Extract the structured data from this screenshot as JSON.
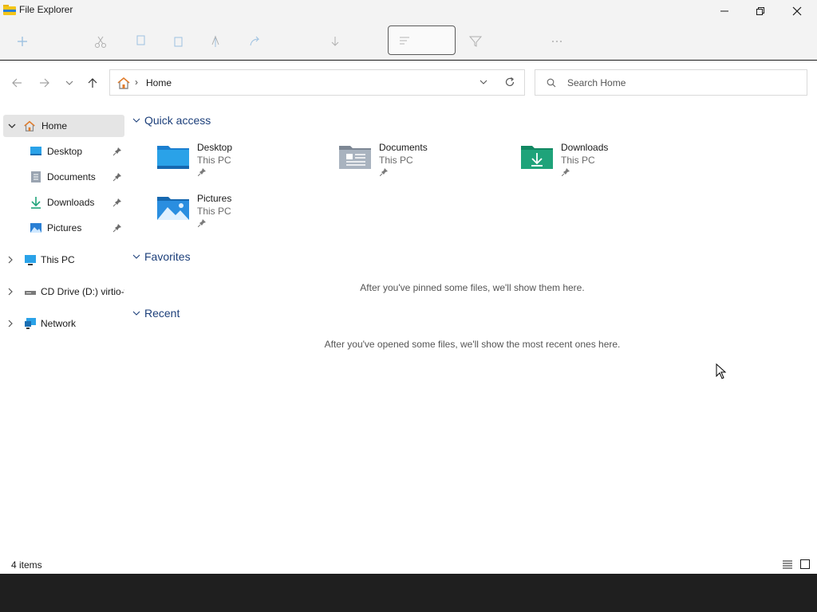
{
  "window": {
    "title": "File Explorer"
  },
  "address": {
    "location": "Home",
    "separator": "›"
  },
  "search": {
    "placeholder": "Search Home"
  },
  "sidebar": {
    "items": [
      {
        "label": "Home"
      },
      {
        "label": "Desktop"
      },
      {
        "label": "Documents"
      },
      {
        "label": "Downloads"
      },
      {
        "label": "Pictures"
      },
      {
        "label": "This PC"
      },
      {
        "label": "CD Drive (D:) virtio-win"
      },
      {
        "label": "Network"
      }
    ]
  },
  "content": {
    "quick_access": {
      "title": "Quick access",
      "tiles": [
        {
          "name": "Desktop",
          "location": "This PC"
        },
        {
          "name": "Documents",
          "location": "This PC"
        },
        {
          "name": "Downloads",
          "location": "This PC"
        },
        {
          "name": "Pictures",
          "location": "This PC"
        }
      ]
    },
    "favorites": {
      "title": "Favorites",
      "empty_message": "After you've pinned some files, we'll show them here."
    },
    "recent": {
      "title": "Recent",
      "empty_message": "After you've opened some files, we'll show the most recent ones here."
    }
  },
  "status": {
    "item_count": "4 items"
  },
  "colors": {
    "accent": "#0067c0",
    "folder_blue": "#2aa2e8",
    "downloads_green": "#1fa37a",
    "heading": "#1c3f7a"
  }
}
